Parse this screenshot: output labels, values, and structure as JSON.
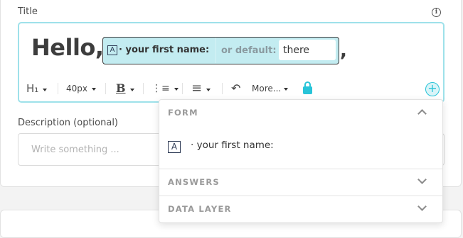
{
  "title_field": {
    "label": "Title",
    "info_icon": "i",
    "greeting": "Hello,",
    "variable_chip": {
      "glyph": "A",
      "name": "· your first name:",
      "default_label": "or default:",
      "default_value": "there"
    },
    "trailing": ","
  },
  "toolbar": {
    "heading": "H₁",
    "font_size": "40px",
    "bold": "B",
    "list_icon": "⋮≡",
    "align_icon": "≡",
    "undo_icon": "↶",
    "more": "More...",
    "lock_icon": "lock-icon",
    "insert_icon": "+"
  },
  "description_field": {
    "label": "Description (optional)",
    "placeholder": "Write something ..."
  },
  "dropdown": {
    "sections": [
      {
        "title": "FORM",
        "expanded": true
      },
      {
        "title": "ANSWERS",
        "expanded": false
      },
      {
        "title": "DATA LAYER",
        "expanded": false
      }
    ],
    "form_items": [
      {
        "glyph": "A",
        "label": "·  your first name:"
      }
    ]
  },
  "colors": {
    "accent": "#28c4d8",
    "chip_bg": "#c3ecf1",
    "editor_border": "#9ee1ea"
  }
}
